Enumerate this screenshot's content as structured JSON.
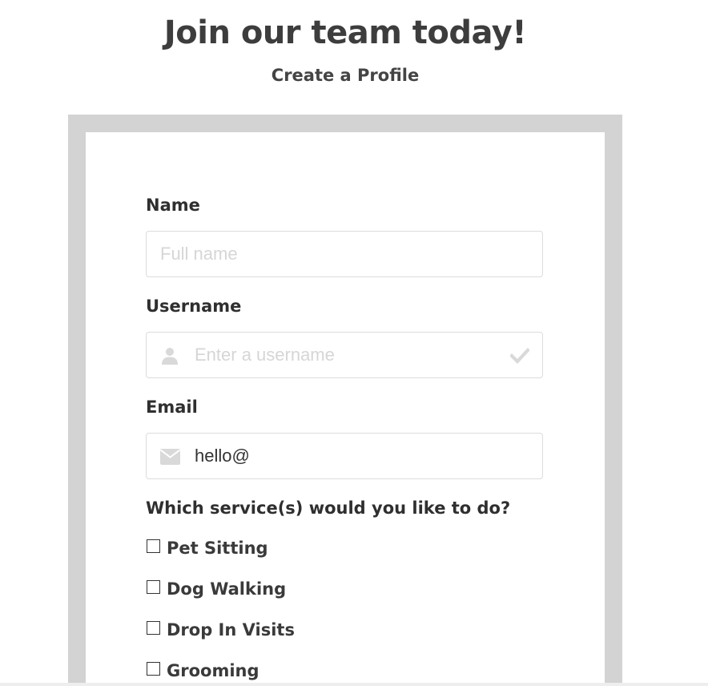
{
  "header": {
    "title": "Join our team today!",
    "subtitle": "Create a Profile"
  },
  "form": {
    "name": {
      "label": "Name",
      "placeholder": "Full name",
      "value": ""
    },
    "username": {
      "label": "Username",
      "placeholder": "Enter a username",
      "value": "",
      "left_icon": "user-icon",
      "right_icon": "checkmark-icon"
    },
    "email": {
      "label": "Email",
      "placeholder": "",
      "value": "hello@",
      "left_icon": "envelope-icon"
    },
    "services": {
      "question": "Which service(s) would you like to do?",
      "options": [
        {
          "label": "Pet Sitting",
          "checked": false
        },
        {
          "label": "Dog Walking",
          "checked": false
        },
        {
          "label": "Drop In Visits",
          "checked": false
        },
        {
          "label": "Grooming",
          "checked": false
        }
      ]
    }
  },
  "colors": {
    "frame": "#d3d3d3",
    "text": "#333333",
    "placeholder": "#d6d6d6",
    "icon": "#d9d9d9"
  }
}
